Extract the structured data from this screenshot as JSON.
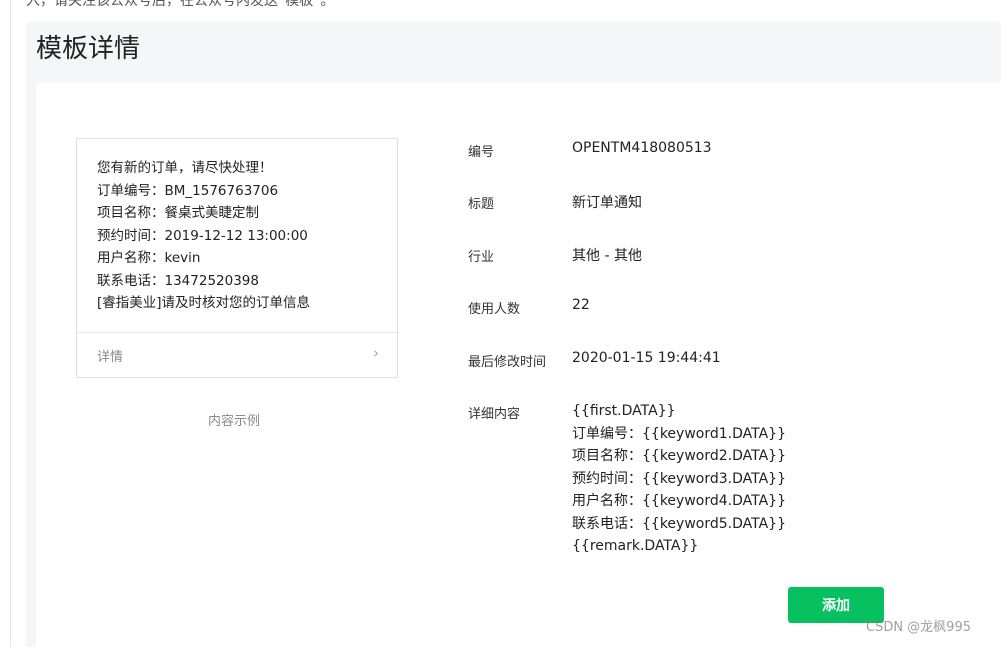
{
  "top_text": "入，请关注该公众号后，在公众号内发送“模板”。",
  "page_title": "模板详情",
  "preview": {
    "lines": [
      "您有新的订单，请尽快处理！",
      "订单编号：BM_1576763706",
      "项目名称：餐桌式美睫定制",
      "预约时间：2019-12-12 13:00:00",
      "用户名称：kevin",
      "联系电话：13472520398",
      "[睿指美业]请及时核对您的订单信息"
    ],
    "detail_label": "详情",
    "chevron": "›"
  },
  "sample_caption": "内容示例",
  "fields": [
    {
      "label": "编号",
      "value": "OPENTM418080513"
    },
    {
      "label": "标题",
      "value": "新订单通知"
    },
    {
      "label": "行业",
      "value": "其他 - 其他"
    },
    {
      "label": "使用人数",
      "value": "22"
    },
    {
      "label": "最后修改时间",
      "value": "2020-01-15 19:44:41"
    }
  ],
  "content": {
    "label": "详细内容",
    "lines": [
      "{{first.DATA}}",
      "订单编号：{{keyword1.DATA}}",
      "项目名称：{{keyword2.DATA}}",
      "预约时间：{{keyword3.DATA}}",
      "用户名称：{{keyword4.DATA}}",
      "联系电话：{{keyword5.DATA}}",
      "{{remark.DATA}}"
    ]
  },
  "add_button_label": "添加",
  "watermark": "CSDN @龙枫995",
  "colors": {
    "accent": "#07c160",
    "panel_bg": "#f5f6f7"
  }
}
